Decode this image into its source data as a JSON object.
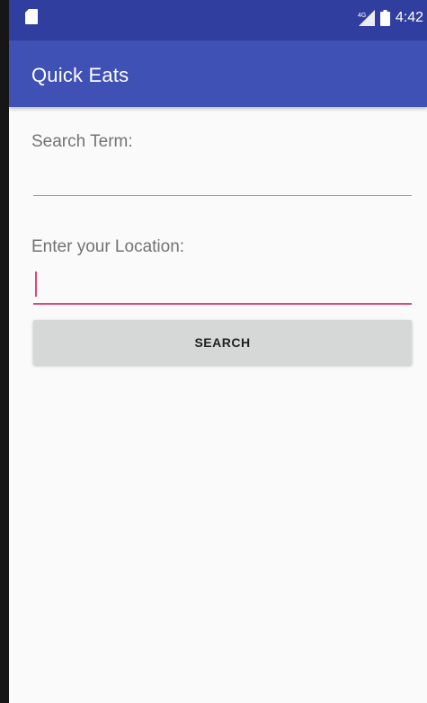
{
  "status_bar": {
    "time": "4:42",
    "left_icon": "sd-card-icon",
    "network_icon": "signal-4g-icon",
    "battery_icon": "battery-icon"
  },
  "app_bar": {
    "title": "Quick Eats",
    "color": "#3f51b5",
    "status_color": "#303f9f"
  },
  "form": {
    "search_term_label": "Search Term:",
    "search_term_value": "",
    "location_label": "Enter your Location:",
    "location_value": "",
    "accent_color": "#e0457b",
    "search_button_label": "SEARCH"
  }
}
